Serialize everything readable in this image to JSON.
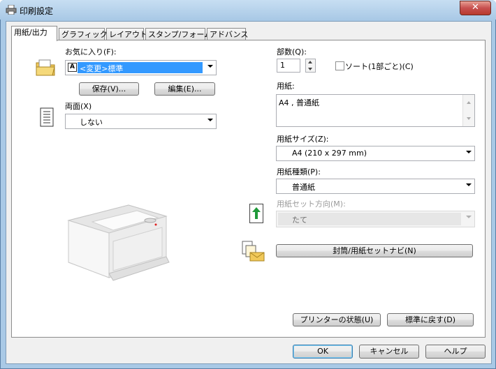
{
  "window": {
    "title": "印刷設定",
    "close_label": "✕"
  },
  "tabs": [
    "用紙/出力",
    "グラフィックス",
    "レイアウト",
    "スタンプ/フォーム",
    "アドバンス"
  ],
  "favorites": {
    "label": "お気に入り(F):",
    "value": "<変更>標準",
    "save_label": "保存(V)...",
    "edit_label": "編集(E)..."
  },
  "duplex": {
    "label": "両面(X)",
    "value": "しない"
  },
  "copies": {
    "label": "部数(Q):",
    "value": "1"
  },
  "collate": {
    "label": "ソート(1部ごと)(C)",
    "checked": false
  },
  "paper_summary": {
    "label": "用紙:",
    "value": "A4 , 普通紙"
  },
  "paper_size": {
    "label": "用紙サイズ(Z):",
    "value": "A4 (210 x 297 mm)"
  },
  "paper_type": {
    "label": "用紙種類(P):",
    "value": "普通紙"
  },
  "paper_orientation": {
    "label": "用紙セット方向(M):",
    "value": "たて"
  },
  "envelope_nav_label": "封筒/用紙セットナビ(N)",
  "printer_status_label": "プリンターの状態(U)",
  "restore_defaults_label": "標準に戻す(D)",
  "ok_label": "OK",
  "cancel_label": "キャンセル",
  "help_label": "ヘルプ",
  "colors": {
    "title_bar": "#a9c9e6",
    "close_button": "#c75050",
    "selection": "#3399ff",
    "arrow_green": "#1f9a3a"
  }
}
